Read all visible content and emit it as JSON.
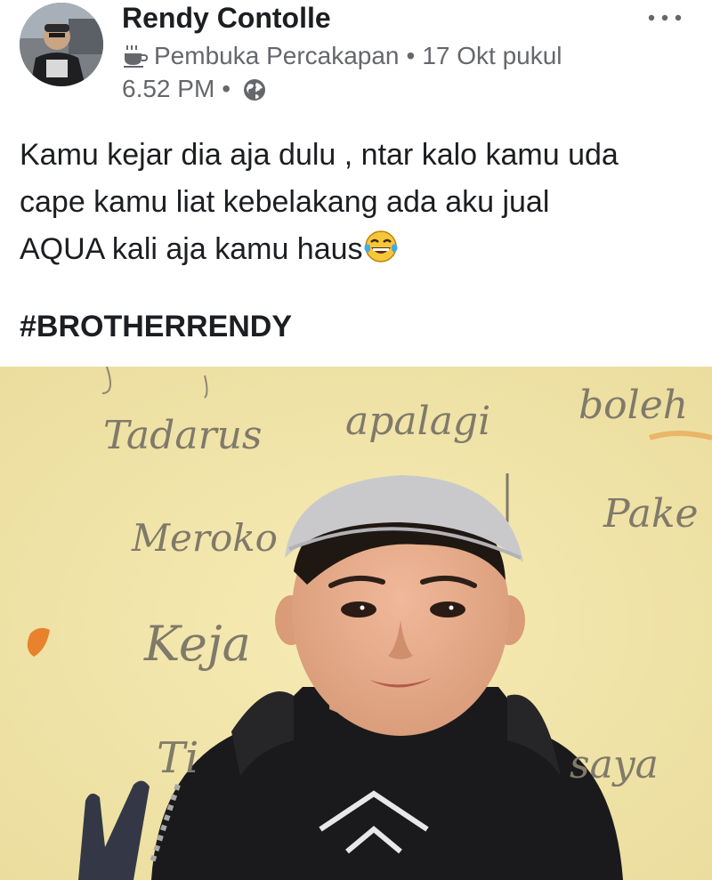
{
  "post": {
    "author": "Rendy Contolle",
    "badge": "Pembuka Percakapan",
    "time_part1": "17 Okt pukul",
    "time_part2": "6.52 PM",
    "separator": "•",
    "text_lines": [
      "Kamu kejar dia aja dulu , ntar kalo kamu uda",
      "cape kamu liat kebelakang ada aku jual",
      "AQUA kali aja kamu haus"
    ],
    "hashtag": "#BROTHERRENDY"
  },
  "photo": {
    "wall_words": [
      "Tadarus",
      "apalagi",
      "boleh",
      "Meroko",
      "Pake",
      "Keja",
      "Ti",
      "saya"
    ]
  },
  "icons": {
    "badge": "coffee-cup-icon",
    "privacy": "globe-icon",
    "emoji": "tears-of-joy-emoji",
    "menu": "more-options-icon"
  }
}
